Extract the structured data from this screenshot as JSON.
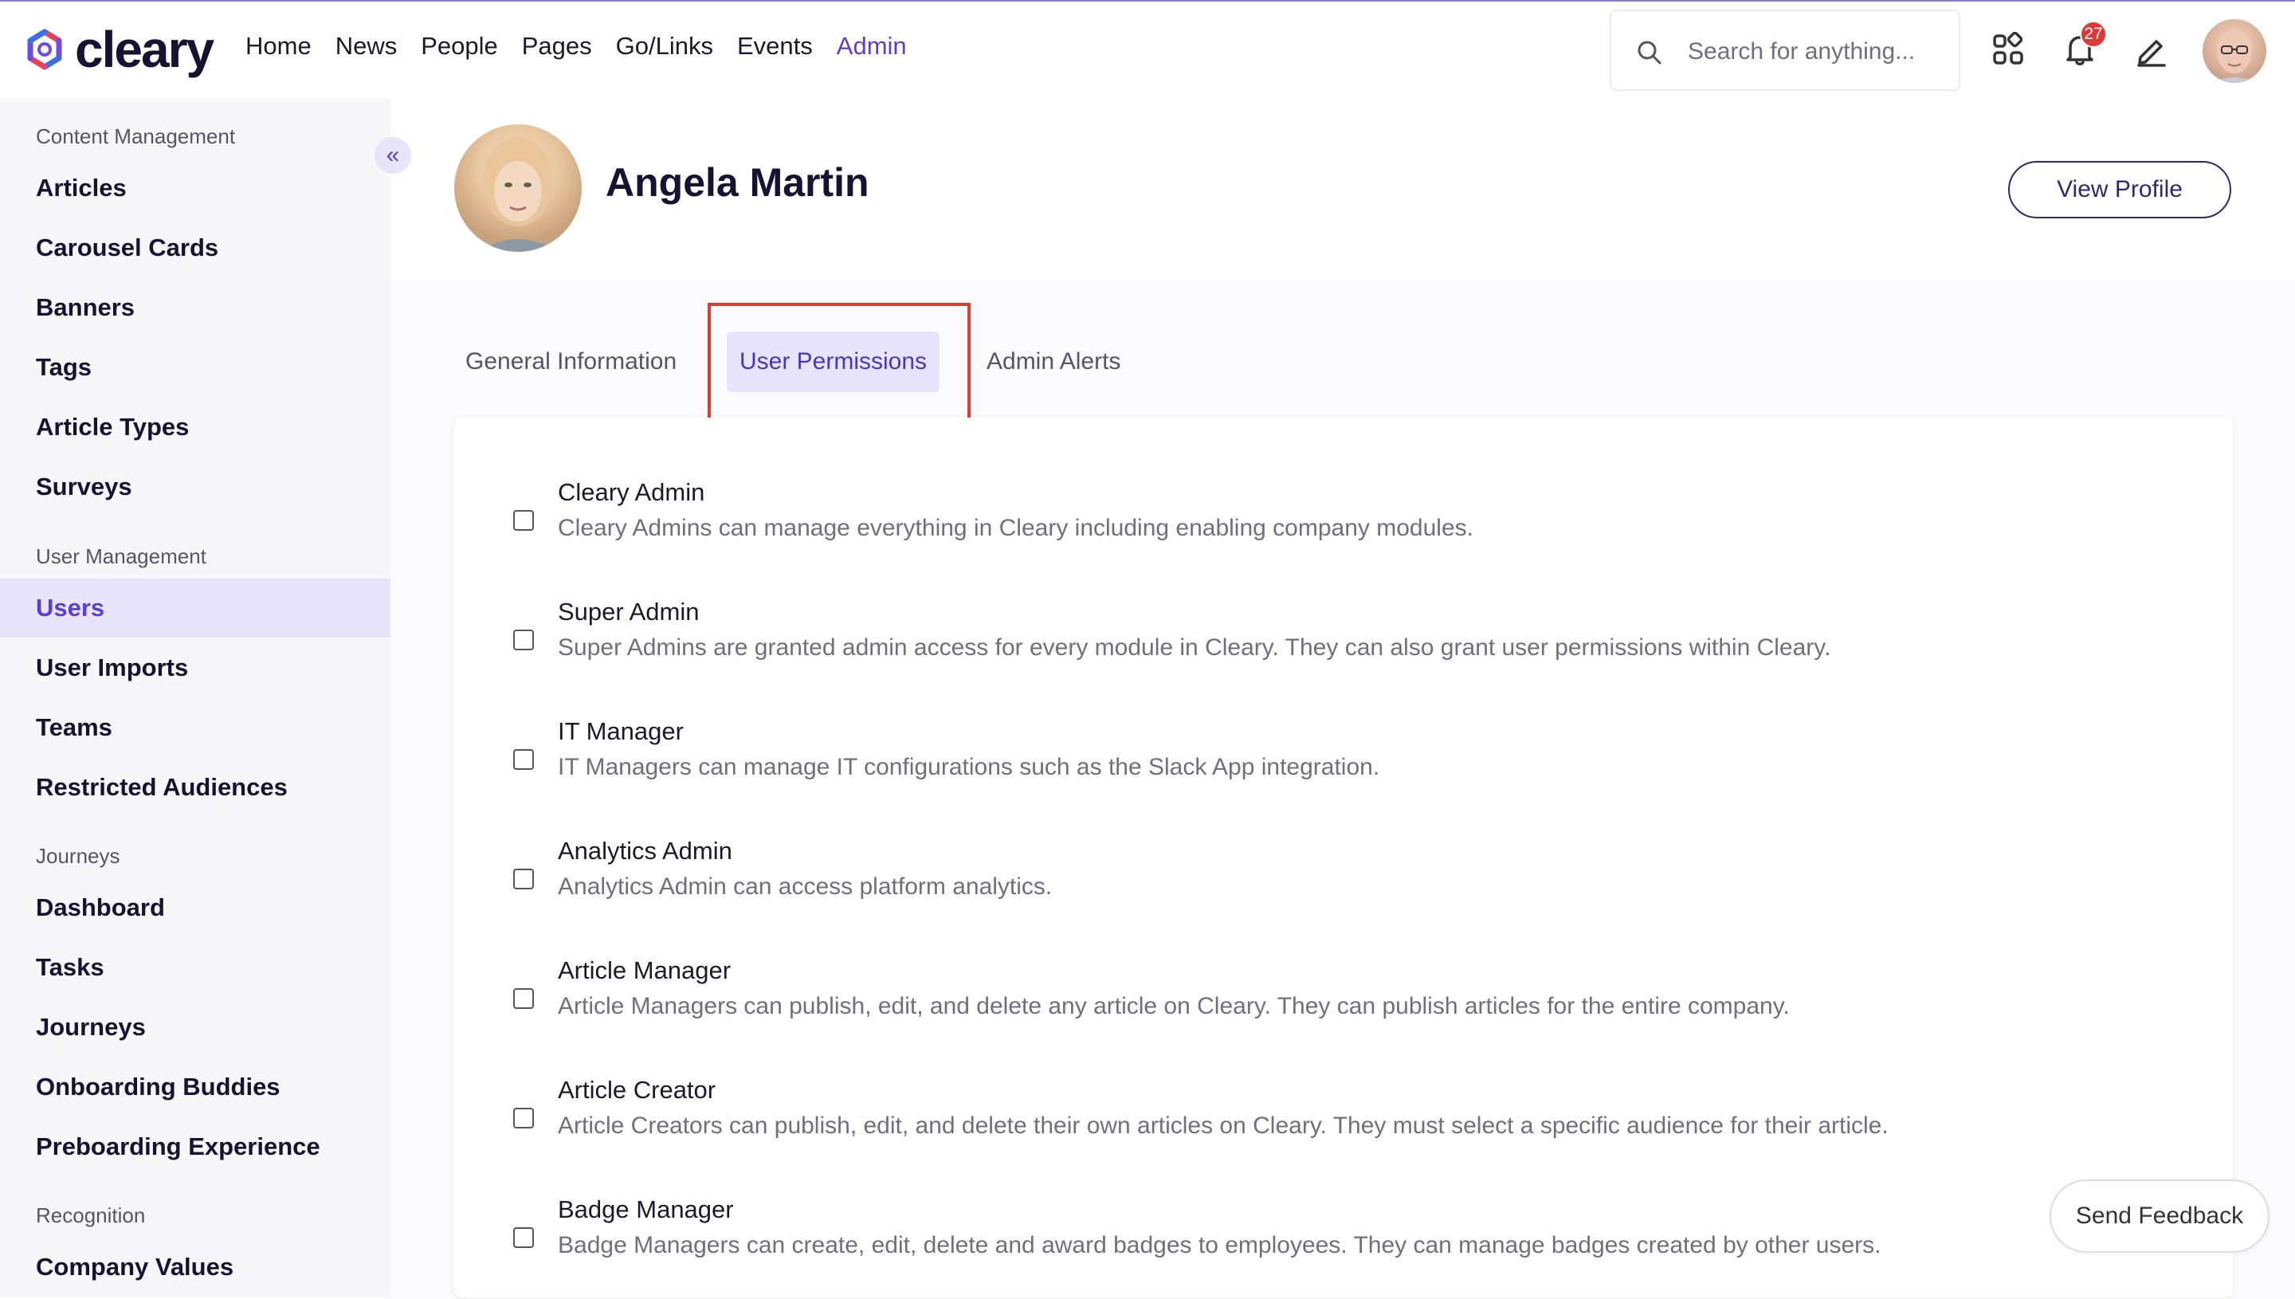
{
  "app": {
    "logo_text": "cleary"
  },
  "nav": {
    "items": [
      {
        "label": "Home",
        "active": false
      },
      {
        "label": "News",
        "active": false
      },
      {
        "label": "People",
        "active": false
      },
      {
        "label": "Pages",
        "active": false
      },
      {
        "label": "Go/Links",
        "active": false
      },
      {
        "label": "Events",
        "active": false
      },
      {
        "label": "Admin",
        "active": true
      }
    ]
  },
  "search": {
    "placeholder": "Search for anything..."
  },
  "notifications": {
    "count": "27"
  },
  "icons": [
    "grid-icon",
    "bell-icon",
    "pencil-icon"
  ],
  "colors": {
    "accent": "#5b3fd3",
    "highlight": "#d8412f",
    "badge": "#e03737"
  },
  "sidebar": {
    "sections": [
      {
        "label": "Content Management",
        "items": [
          "Articles",
          "Carousel Cards",
          "Banners",
          "Tags",
          "Article Types",
          "Surveys"
        ]
      },
      {
        "label": "User Management",
        "items": [
          "Users",
          "User Imports",
          "Teams",
          "Restricted Audiences"
        ]
      },
      {
        "label": "Journeys",
        "items": [
          "Dashboard",
          "Tasks",
          "Journeys",
          "Onboarding Buddies",
          "Preboarding Experience"
        ]
      },
      {
        "label": "Recognition",
        "items": [
          "Company Values"
        ]
      }
    ],
    "active_item": "Users"
  },
  "profile": {
    "name": "Angela Martin",
    "view_profile_label": "View Profile"
  },
  "tabs": [
    {
      "label": "General Information",
      "active": false
    },
    {
      "label": "User Permissions",
      "active": true
    },
    {
      "label": "Admin Alerts",
      "active": false
    }
  ],
  "permissions": [
    {
      "title": "Cleary Admin",
      "description": "Cleary Admins can manage everything in Cleary including enabling company modules.",
      "checked": false
    },
    {
      "title": "Super Admin",
      "description": "Super Admins are granted admin access for every module in Cleary. They can also grant user permissions within Cleary.",
      "checked": false
    },
    {
      "title": "IT Manager",
      "description": "IT Managers can manage IT configurations such as the Slack App integration.",
      "checked": false
    },
    {
      "title": "Analytics Admin",
      "description": "Analytics Admin can access platform analytics.",
      "checked": false
    },
    {
      "title": "Article Manager",
      "description": "Article Managers can publish, edit, and delete any article on Cleary. They can publish articles for the entire company.",
      "checked": false
    },
    {
      "title": "Article Creator",
      "description": "Article Creators can publish, edit, and delete their own articles on Cleary. They must select a specific audience for their article.",
      "checked": false
    },
    {
      "title": "Badge Manager",
      "description": "Badge Managers can create, edit, delete and award badges to employees. They can manage badges created by other users.",
      "checked": false
    }
  ],
  "feedback": {
    "label": "Send Feedback"
  }
}
